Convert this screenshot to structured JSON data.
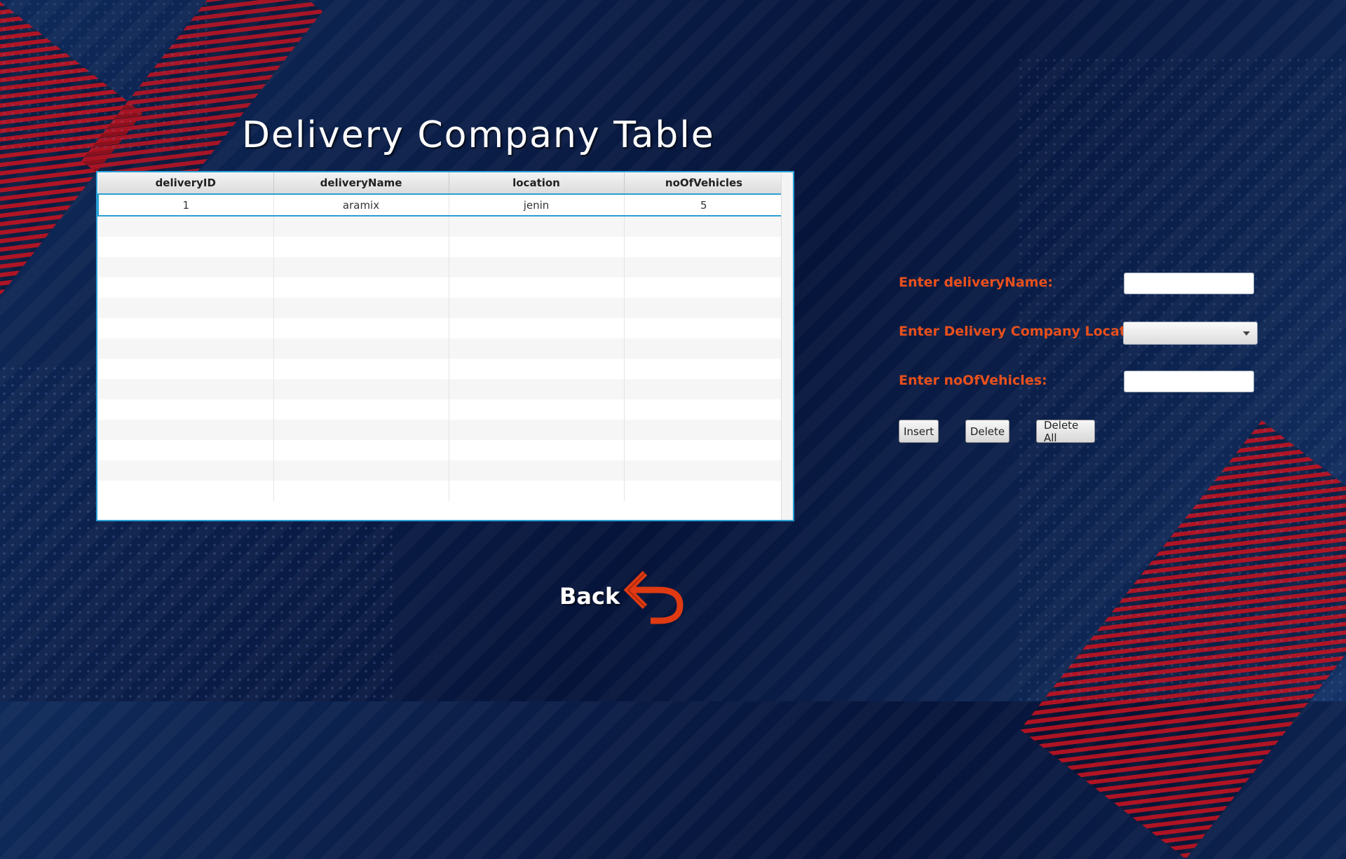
{
  "page": {
    "title": "Delivery Company Table"
  },
  "table": {
    "columns": [
      "deliveryID",
      "deliveryName",
      "location",
      "noOfVehicles"
    ],
    "rows": [
      [
        "1",
        "aramix",
        "jenin",
        "5"
      ]
    ],
    "selected_row": 0,
    "empty_rows": 14
  },
  "form": {
    "delivery_name_label": "Enter deliveryName:",
    "delivery_name_value": "",
    "location_label": "Enter Delivery Company Location:",
    "location_value": "",
    "vehicles_label": "Enter noOfVehicles:",
    "vehicles_value": ""
  },
  "buttons": {
    "insert": "Insert",
    "delete": "Delete",
    "delete_all": "Delete All"
  },
  "back": {
    "label": "Back",
    "icon": "back-arrow-icon"
  },
  "colors": {
    "label_orange": "#e8501c",
    "selection_blue": "#2a9fd6",
    "background_navy": "#0b1e48",
    "accent_red": "#c1121f"
  }
}
